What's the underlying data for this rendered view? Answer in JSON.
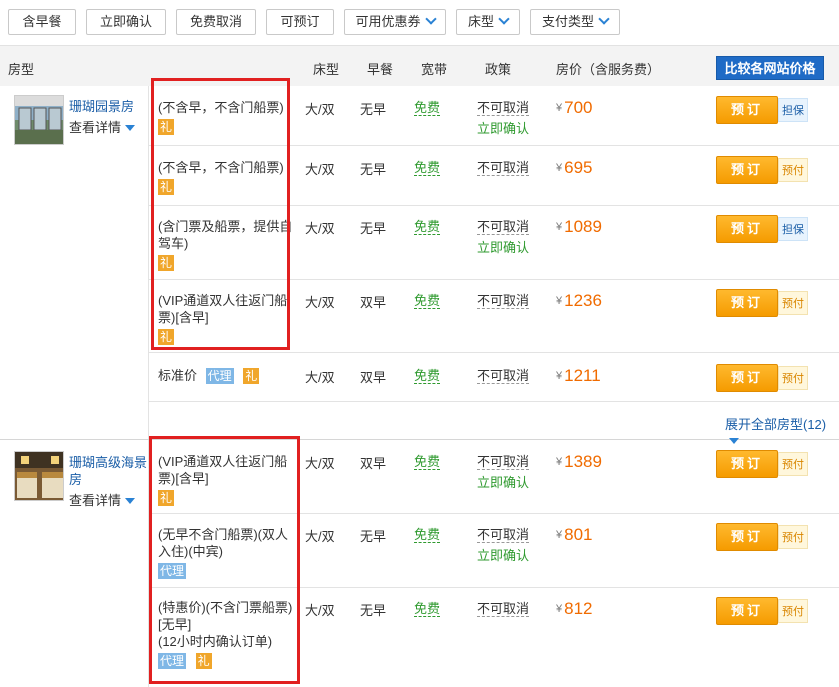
{
  "filters": [
    {
      "label": "含早餐",
      "dropdown": false
    },
    {
      "label": "立即确认",
      "dropdown": false
    },
    {
      "label": "免费取消",
      "dropdown": false
    },
    {
      "label": "可预订",
      "dropdown": false
    },
    {
      "label": "可用优惠券",
      "dropdown": true
    },
    {
      "label": "床型",
      "dropdown": true
    },
    {
      "label": "支付类型",
      "dropdown": true
    }
  ],
  "header": {
    "room_type": "房型",
    "bed": "床型",
    "breakfast": "早餐",
    "broadband": "宽带",
    "policy": "政策",
    "price": "房价（含服务费）",
    "compare_btn": "比较各网站价格"
  },
  "rooms": [
    {
      "name": "珊瑚园景房",
      "detail": "查看详情",
      "rates": [
        {
          "desc_lines": [
            "(不含早，不含门船票)"
          ],
          "badges": [
            "礼"
          ],
          "bed": "大/双",
          "breakfast": "无早",
          "broadband": "免费",
          "policy": "不可取消",
          "confirm": "立即确认",
          "yen": "¥",
          "price": "700",
          "book": "预订",
          "pay": "担保"
        },
        {
          "desc_lines": [
            "(不含早，不含门船票)"
          ],
          "badges": [
            "礼"
          ],
          "bed": "大/双",
          "breakfast": "无早",
          "broadband": "免费",
          "policy": "不可取消",
          "confirm": "",
          "yen": "¥",
          "price": "695",
          "book": "预订",
          "pay": "预付"
        },
        {
          "desc_lines": [
            "(含门票及船票，提供自",
            "驾车)"
          ],
          "badges": [
            "礼"
          ],
          "bed": "大/双",
          "breakfast": "无早",
          "broadband": "免费",
          "policy": "不可取消",
          "confirm": "立即确认",
          "yen": "¥",
          "price": "1089",
          "book": "预订",
          "pay": "担保"
        },
        {
          "desc_lines": [
            "(VIP通道双人往返门船",
            "票)[含早]"
          ],
          "badges": [
            "礼"
          ],
          "bed": "大/双",
          "breakfast": "双早",
          "broadband": "免费",
          "policy": "不可取消",
          "confirm": "",
          "yen": "¥",
          "price": "1236",
          "book": "预订",
          "pay": "预付"
        },
        {
          "desc_lines": [
            "标准价"
          ],
          "badges": [
            "代理",
            "礼"
          ],
          "bed": "大/双",
          "breakfast": "双早",
          "broadband": "免费",
          "policy": "不可取消",
          "confirm": "",
          "yen": "¥",
          "price": "1211",
          "book": "预订",
          "pay": "预付"
        }
      ],
      "expand": "展开全部房型(12)"
    },
    {
      "name": "珊瑚高级海景房",
      "detail": "查看详情",
      "rates": [
        {
          "desc_lines": [
            "(VIP通道双人往返门船",
            "票)[含早]"
          ],
          "badges": [
            "礼"
          ],
          "bed": "大/双",
          "breakfast": "双早",
          "broadband": "免费",
          "policy": "不可取消",
          "confirm": "立即确认",
          "yen": "¥",
          "price": "1389",
          "book": "预订",
          "pay": "预付"
        },
        {
          "desc_lines": [
            "(无早不含门船票)(双人",
            "入住)(中宾)"
          ],
          "badges": [
            "代理"
          ],
          "bed": "大/双",
          "breakfast": "无早",
          "broadband": "免费",
          "policy": "不可取消",
          "confirm": "立即确认",
          "yen": "¥",
          "price": "801",
          "book": "预订",
          "pay": "预付"
        },
        {
          "desc_lines": [
            "(特惠价)(不含门票船票)",
            "[无早]",
            "(12小时内确认订单)"
          ],
          "badges": [
            "代理",
            "礼"
          ],
          "bed": "大/双",
          "breakfast": "无早",
          "broadband": "免费",
          "policy": "不可取消",
          "confirm": "",
          "yen": "¥",
          "price": "812",
          "book": "预订",
          "pay": "预付"
        }
      ]
    }
  ]
}
